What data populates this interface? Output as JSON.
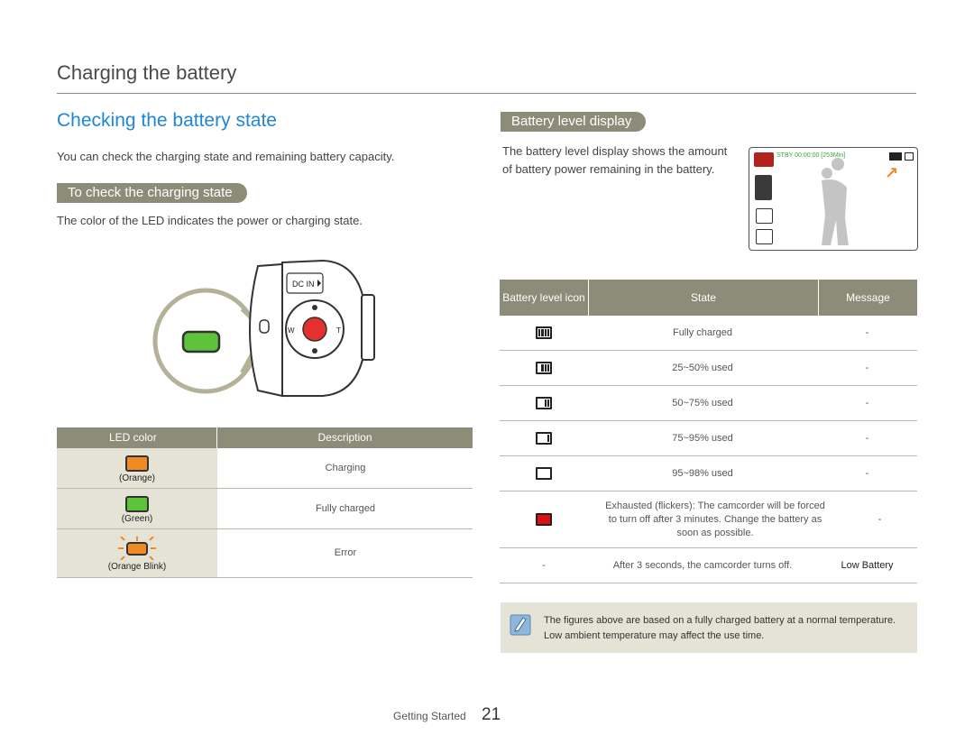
{
  "page_title": "Charging the battery",
  "section_heading": "Checking the battery state",
  "intro": "You can check the charging state and remaining battery capacity.",
  "led_section": {
    "heading": "To check the charging state",
    "description": "The color of the LED indicates the power or charging state.",
    "camera_label": "DC IN",
    "zoom_w": "W",
    "zoom_t": "T",
    "table": {
      "headers": [
        "LED color",
        "Description"
      ],
      "rows": [
        {
          "led": "(Orange)",
          "color": "#f08a24",
          "description": "Charging"
        },
        {
          "led": "(Green)",
          "color": "#5ec23a",
          "description": "Fully charged"
        },
        {
          "led": "(Orange Blink)",
          "color": "#f08a24",
          "description": "Error"
        }
      ]
    }
  },
  "battery_section": {
    "heading": "Battery level display",
    "description": "The battery level display shows the amount of battery power remaining in the battery.",
    "screen_status": "STBY 00:00:00 [253Min]",
    "table": {
      "headers": [
        "Battery level icon",
        "State",
        "Message"
      ],
      "rows": [
        {
          "level": 4,
          "state": "Fully charged",
          "message": "-"
        },
        {
          "level": 3,
          "state": "25~50% used",
          "message": "-"
        },
        {
          "level": 2,
          "state": "50~75% used",
          "message": "-"
        },
        {
          "level": 1,
          "state": "75~95% used",
          "message": "-"
        },
        {
          "level": 0,
          "state": "95~98% used",
          "message": "-"
        },
        {
          "level": -1,
          "state": "Exhausted (flickers): The camcorder will be forced to turn off after 3 minutes. Change the battery as soon as possible.",
          "message": "-"
        },
        {
          "level": null,
          "icon_text": "-",
          "state": "After 3 seconds, the camcorder turns off.",
          "message": "Low Battery"
        }
      ]
    }
  },
  "note": "The figures above are based on a fully charged battery at a normal temperature. Low ambient temperature may affect the use time.",
  "footer": {
    "section": "Getting Started",
    "page": "21"
  },
  "colors": {
    "accent_blue": "#1f86d6",
    "pill_gray": "#8d8c79",
    "table_bg": "#e4e3d6"
  }
}
